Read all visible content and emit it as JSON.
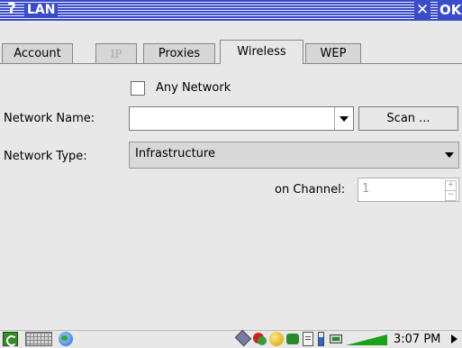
{
  "window": {
    "title": "LAN",
    "help_glyph": "?",
    "close_glyph": "✕",
    "ok_label": "OK"
  },
  "tabs": [
    {
      "label": "Account",
      "active": false,
      "enabled": true
    },
    {
      "label": "IP",
      "active": false,
      "enabled": false
    },
    {
      "label": "Proxies",
      "active": false,
      "enabled": true
    },
    {
      "label": "Wireless",
      "active": true,
      "enabled": true
    },
    {
      "label": "WEP",
      "active": false,
      "enabled": true
    }
  ],
  "wireless": {
    "any_network_label": "Any Network",
    "any_network_checked": false,
    "network_name_label": "Network Name:",
    "network_name_value": "",
    "scan_label": "Scan ...",
    "network_type_label": "Network Type:",
    "network_type_value": "Infrastructure",
    "channel_label": "on Channel:",
    "channel_value": "1"
  },
  "taskbar": {
    "start_icon": "start-menu-icon",
    "keyboard_icon": "keyboard-icon",
    "network_icon": "globe-icon",
    "tray_icons": [
      "pen-icon",
      "security-icon",
      "media-icon",
      "sync-icon",
      "clipboard-icon",
      "battery-icon",
      "connection-icon",
      "signal-icon"
    ],
    "clock": "3:07 PM"
  },
  "colors": {
    "titlebar": "#3b4cc8",
    "background": "#e8e8e8",
    "signal": "#1aa01a"
  }
}
